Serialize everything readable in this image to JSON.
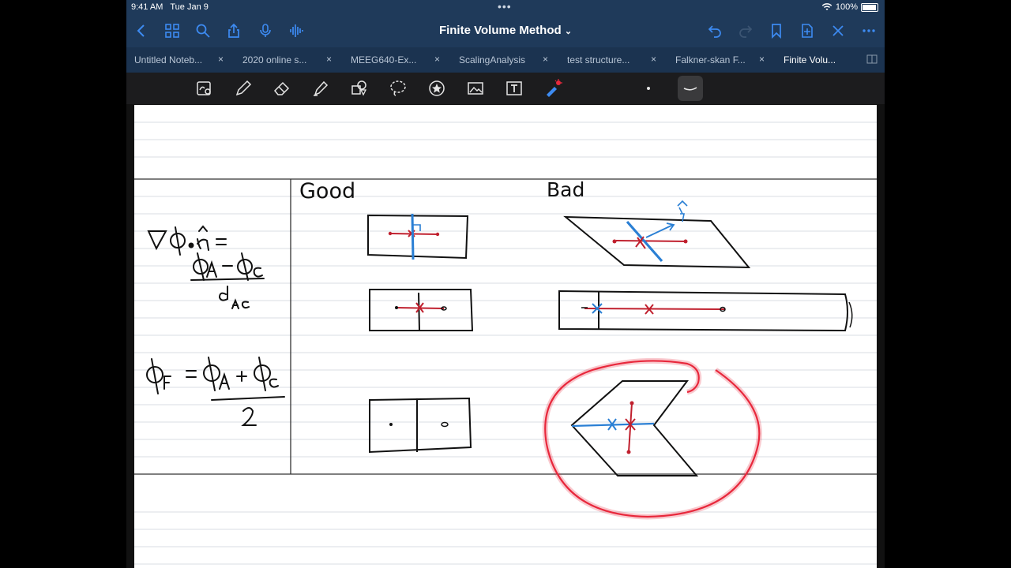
{
  "status": {
    "time": "9:41 AM",
    "date": "Tue Jan 9",
    "battery": "100%"
  },
  "navbar": {
    "title": "Finite Volume Method",
    "title_chevron": "⌄"
  },
  "tabs": [
    {
      "label": "Untitled Noteb...",
      "close": "×"
    },
    {
      "label": "2020 online s...",
      "close": "×"
    },
    {
      "label": "MEEG640-Ex...",
      "close": "×"
    },
    {
      "label": "ScalingAnalysis",
      "close": "×"
    },
    {
      "label": "test structure...",
      "close": "×"
    },
    {
      "label": "Falkner-skan F...",
      "close": "×"
    },
    {
      "label": "Finite Volu...",
      "close": ""
    }
  ],
  "notes": {
    "heading_good": "Good",
    "heading_bad": "Bad"
  },
  "colors": {
    "navbar": "#1f3a5a",
    "ink_red": "#c0202e",
    "ink_blue": "#2a7fd4",
    "highlight": "#e8283c"
  }
}
